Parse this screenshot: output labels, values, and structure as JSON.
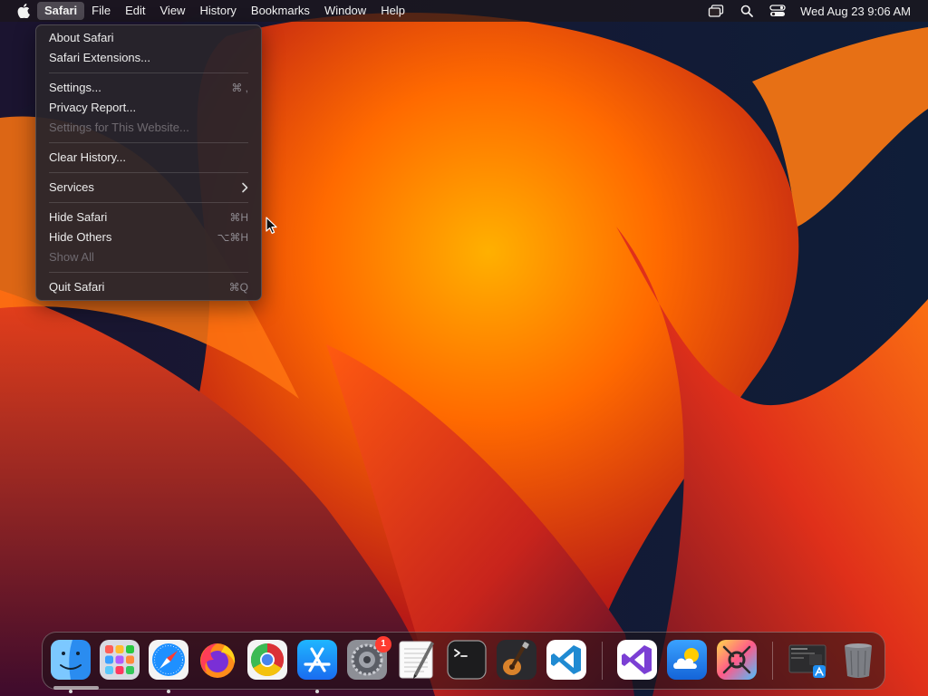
{
  "menubar": {
    "app_name": "Safari",
    "menus": [
      "File",
      "Edit",
      "View",
      "History",
      "Bookmarks",
      "Window",
      "Help"
    ],
    "status_icons": [
      "window-stack-icon",
      "search-icon",
      "control-center-icon"
    ],
    "clock": "Wed Aug 23  9:06 AM"
  },
  "app_menu": {
    "items": {
      "about": {
        "label": "About Safari"
      },
      "extensions": {
        "label": "Safari Extensions..."
      },
      "settings": {
        "label": "Settings...",
        "shortcut": "⌘ ,"
      },
      "privacy": {
        "label": "Privacy Report..."
      },
      "site_settings": {
        "label": "Settings for This Website...",
        "disabled": true
      },
      "clear_history": {
        "label": "Clear History..."
      },
      "services": {
        "label": "Services",
        "submenu": true
      },
      "hide": {
        "label": "Hide Safari",
        "shortcut": "⌘H"
      },
      "hide_others": {
        "label": "Hide Others",
        "shortcut": "⌥⌘H"
      },
      "show_all": {
        "label": "Show All",
        "disabled": true
      },
      "quit": {
        "label": "Quit Safari",
        "shortcut": "⌘Q"
      }
    }
  },
  "dock": {
    "apps": [
      {
        "name": "Finder",
        "icon": "finder-icon",
        "running": true
      },
      {
        "name": "Launchpad",
        "icon": "launchpad-icon",
        "running": false
      },
      {
        "name": "Safari",
        "icon": "safari-icon",
        "running": true
      },
      {
        "name": "Firefox",
        "icon": "firefox-icon",
        "running": false
      },
      {
        "name": "Google Chrome",
        "icon": "chrome-icon",
        "running": false
      },
      {
        "name": "App Store",
        "icon": "app-store-icon",
        "running": true
      },
      {
        "name": "System Settings",
        "icon": "system-settings-icon",
        "running": false,
        "badge": "1"
      },
      {
        "name": "TextEdit",
        "icon": "textedit-icon",
        "running": false
      },
      {
        "name": "Terminal",
        "icon": "terminal-icon",
        "running": false
      },
      {
        "name": "GarageBand",
        "icon": "garageband-icon",
        "running": false
      },
      {
        "name": "Visual Studio Code",
        "icon": "vscode-icon",
        "running": false
      },
      {
        "name": "Visual Studio",
        "icon": "visual-studio-icon",
        "running": false
      },
      {
        "name": "Weather",
        "icon": "weather-icon",
        "running": false
      },
      {
        "name": "Color Picker",
        "icon": "color-picker-icon",
        "running": false
      },
      {
        "name": "Downloads Stack",
        "icon": "downloads-stack-icon",
        "running": false
      },
      {
        "name": "Trash",
        "icon": "trash-icon",
        "running": false
      }
    ]
  },
  "colors": {
    "wallpaper_orange": "#ff8a00",
    "wallpaper_red": "#c81e1e",
    "wallpaper_purple": "#4a0f3a",
    "badge_red": "#ff3b30"
  }
}
